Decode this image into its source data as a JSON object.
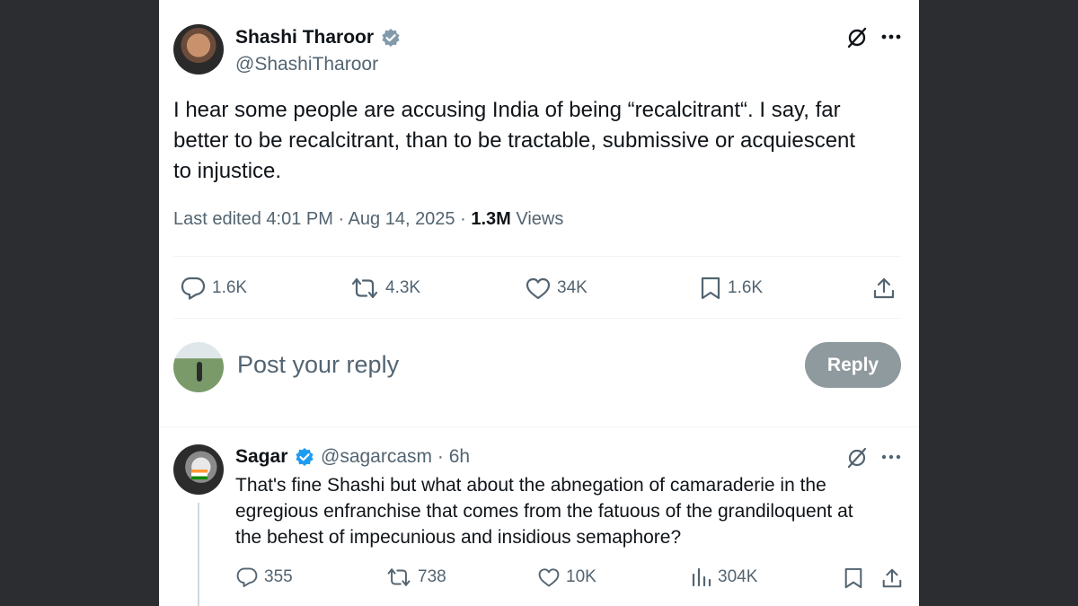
{
  "tweet": {
    "author_name": "Shashi Tharoor",
    "author_handle": "@ShashiTharoor",
    "text_line1": "I hear some people are accusing India of being “recalcitrant“. I say, far",
    "text_line2": "better to be recalcitrant, than to be tractable, submissive or acquiescent",
    "text_line3": "to injustice.",
    "meta_prefix": "Last edited 4:01 PM · Aug 14, 2025 · ",
    "views_count": "1.3M",
    "views_label": " Views",
    "stats": {
      "replies": "1.6K",
      "reposts": "4.3K",
      "likes": "34K",
      "bookmarks": "1.6K"
    }
  },
  "composer": {
    "placeholder": "Post your reply",
    "reply_button": "Reply"
  },
  "reply": {
    "author_name": "Sagar",
    "author_handle": "@sagarcasm",
    "time": " · 6h",
    "text_line1": "That's fine Shashi but what about the abnegation of camaraderie in the",
    "text_line2": "egregious enfranchise that comes from the fatuous of the grandiloquent at",
    "text_line3": "the behest of impecunious and insidious semaphore?",
    "stats": {
      "replies": "355",
      "reposts": "738",
      "likes": "10K",
      "views": "304K"
    }
  },
  "colors": {
    "background": "#2b2d30",
    "panel": "#ffffff",
    "verified_gray": "#829aab",
    "verified_blue": "#1d9bf0",
    "secondary_text": "#536471",
    "reply_button_disabled": "#8f9a9f"
  },
  "icons": [
    "grok-icon",
    "more-icon",
    "reply-icon",
    "repost-icon",
    "like-icon",
    "bookmark-icon",
    "share-icon",
    "views-icon",
    "verified-badge-icon"
  ]
}
